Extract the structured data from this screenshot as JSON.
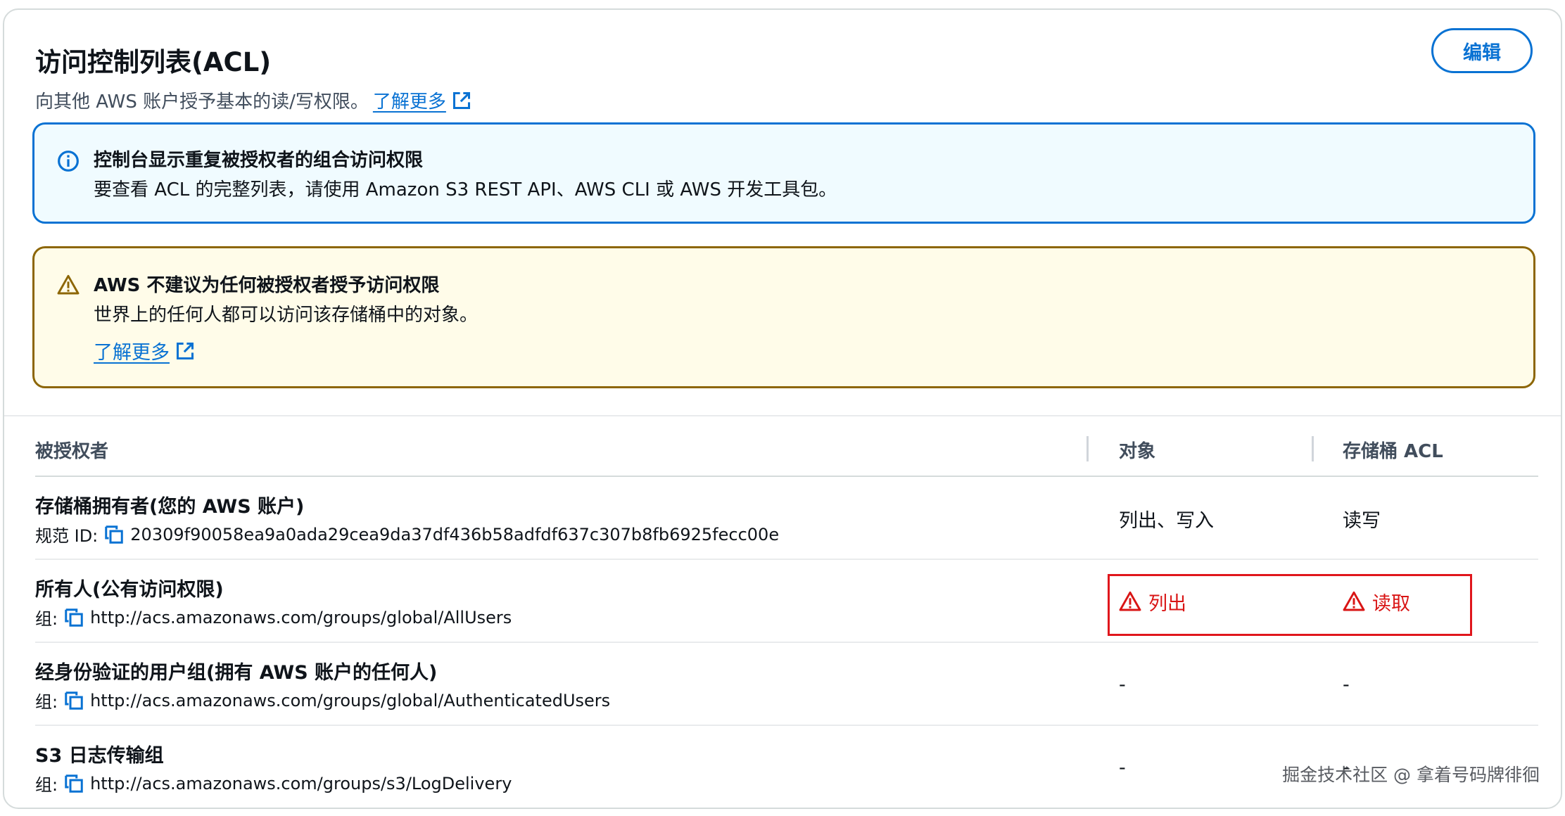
{
  "header": {
    "title": "访问控制列表(ACL)",
    "description": "向其他 AWS 账户授予基本的读/写权限。",
    "learn_more": "了解更多",
    "edit_button": "编辑"
  },
  "info_alert": {
    "title": "控制台显示重复被授权者的组合访问权限",
    "body": "要查看 ACL 的完整列表，请使用 Amazon S3 REST API、AWS CLI 或 AWS 开发工具包。"
  },
  "warning_alert": {
    "title": "AWS 不建议为任何被授权者授予访问权限",
    "body": "世界上的任何人都可以访问该存储桶中的对象。",
    "learn_more": "了解更多"
  },
  "table": {
    "columns": {
      "grantee": "被授权者",
      "object": "对象",
      "bucket_acl": "存储桶 ACL"
    },
    "rows": [
      {
        "name": "存储桶拥有者(您的 AWS 账户)",
        "id_label": "规范 ID:",
        "id_value": "20309f90058ea9a0ada29cea9da37df436b58adfdf637c307b8fb6925fecc00e",
        "object": "列出、写入",
        "bucket_acl": "读写"
      },
      {
        "name": "所有人(公有访问权限)",
        "id_label": "组:",
        "id_value": "http://acs.amazonaws.com/groups/global/AllUsers",
        "object": "列出",
        "bucket_acl": "读取"
      },
      {
        "name": "经身份验证的用户组(拥有 AWS 账户的任何人)",
        "id_label": "组:",
        "id_value": "http://acs.amazonaws.com/groups/global/AuthenticatedUsers",
        "object": "-",
        "bucket_acl": "-"
      },
      {
        "name": "S3 日志传输组",
        "id_label": "组:",
        "id_value": "http://acs.amazonaws.com/groups/s3/LogDelivery",
        "object": "-",
        "bucket_acl": "-"
      }
    ]
  },
  "watermark": "掘金技术社区 @ 拿着号码牌徘徊",
  "colors": {
    "link": "#0972d3",
    "info_border": "#0972d3",
    "info_bg": "#f0fbff",
    "warn_border": "#8d6605",
    "warn_bg": "#fffce9",
    "danger": "#d91515",
    "highlight": "#e0161c"
  }
}
